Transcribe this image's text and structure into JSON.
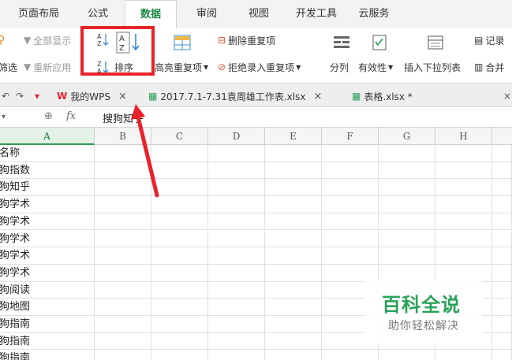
{
  "menu": {
    "tabs": [
      "页面布局",
      "公式",
      "数据",
      "审阅",
      "视图",
      "开发工具",
      "云服务"
    ],
    "active": "数据"
  },
  "ribbon": {
    "show_all": "全部显示",
    "filter": "筛选",
    "reapply": "重新应用",
    "sort": "排序",
    "highlight_duplicates": "高亮重复项",
    "remove_duplicates": "删除重复项",
    "reject_duplicates": "拒绝录入重复项",
    "split_column": "分列",
    "validity": "有效性",
    "insert_dropdown": "插入下拉列表",
    "record": "记录",
    "merge": "合并"
  },
  "doc_tabs": [
    {
      "label": "我的WPS",
      "close": "×"
    },
    {
      "label": "2017.7.1-7.31袁周雄工作表.xlsx",
      "close": "×"
    },
    {
      "label": "表格.xlsx *",
      "close": "×"
    }
  ],
  "formula_bar": {
    "fx": "fx",
    "content": "搜狗知乎"
  },
  "grid": {
    "columns": [
      "A",
      "B",
      "C",
      "D",
      "E",
      "F",
      "G",
      "H"
    ],
    "column_a_values": [
      "名称",
      "狗指数",
      "狗知乎",
      "狗学术",
      "狗学术",
      "狗学术",
      "狗学术",
      "狗学术",
      "狗阅读",
      "狗地图",
      "狗指南",
      "狗指南",
      "狗指南"
    ]
  },
  "watermark": {
    "title": "百科全说",
    "subtitle": "助你轻松解决"
  },
  "colors": {
    "accent_green": "#1e8a45",
    "highlight_red": "#e8232b"
  }
}
